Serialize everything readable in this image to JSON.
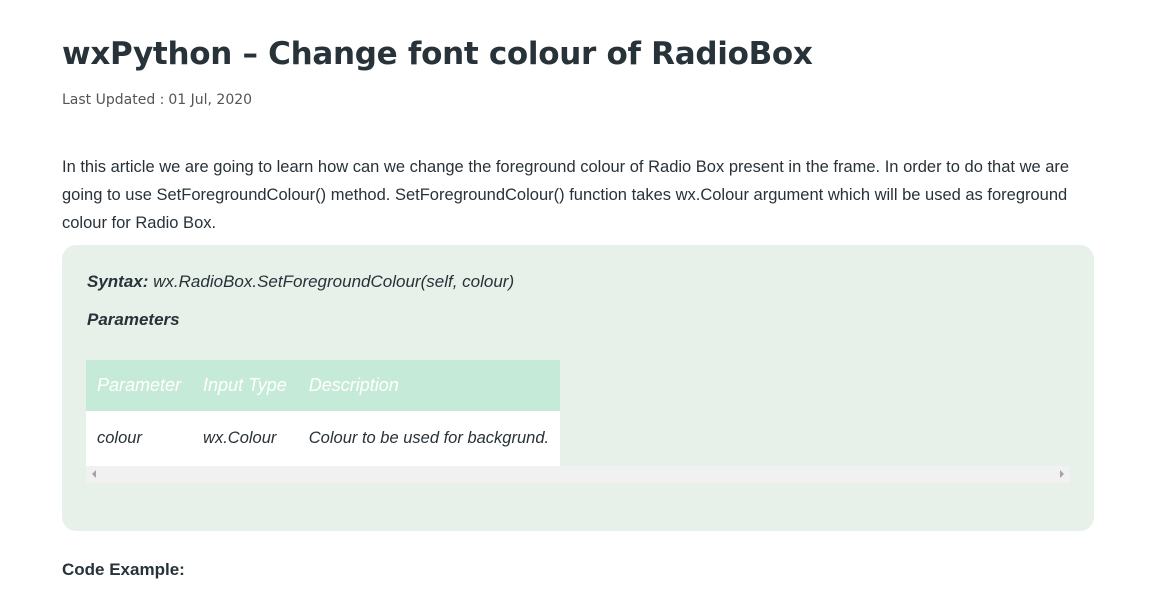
{
  "article": {
    "title": "wxPython – Change font colour of RadioBox",
    "updated_label": "Last Updated :",
    "updated_date": "01 Jul, 2020",
    "intro": "In this article we are going to learn how can we change the foreground colour of Radio Box present in the frame. In order to do that we are going to use SetForegroundColour() method. SetForegroundColour() function takes wx.Colour argument which will be used as foreground colour for Radio Box."
  },
  "syntax_box": {
    "syntax_label": "Syntax:",
    "syntax_value": "wx.RadioBox.SetForegroundColour(self, colour)",
    "parameters_heading": "Parameters",
    "table": {
      "headers": [
        "Parameter",
        "Input Type",
        "Description"
      ],
      "rows": [
        [
          "colour",
          "wx.Colour",
          "Colour to be used for backgrund."
        ]
      ]
    }
  },
  "code_example_heading": "Code Example:",
  "colors": {
    "box_background": "#e8f1e9",
    "table_header_background": "#c5ead8",
    "text": "#273239"
  }
}
